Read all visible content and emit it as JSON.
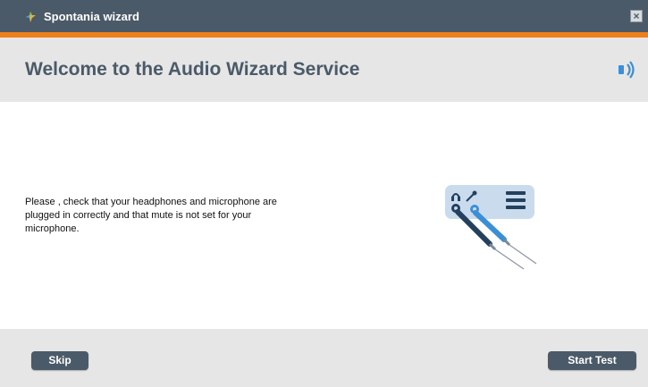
{
  "window": {
    "title": "Spontania wizard",
    "close_label": "×",
    "app_icon": "spontania-logo-icon",
    "colors": {
      "titlebar": "#4b5a68",
      "accent": "#ef7f1a",
      "panel": "#e6e6e6",
      "button": "#4b5a68"
    }
  },
  "header": {
    "title": "Welcome to the Audio Wizard Service",
    "icon": "speaker-icon"
  },
  "main": {
    "instructions": "Please , check that your headphones and microphone are plugged in correctly and that mute is not set for your microphone.",
    "illustration_icon": "headphones-microphone-plugs-icon"
  },
  "footer": {
    "skip_label": "Skip",
    "start_label": "Start Test"
  }
}
